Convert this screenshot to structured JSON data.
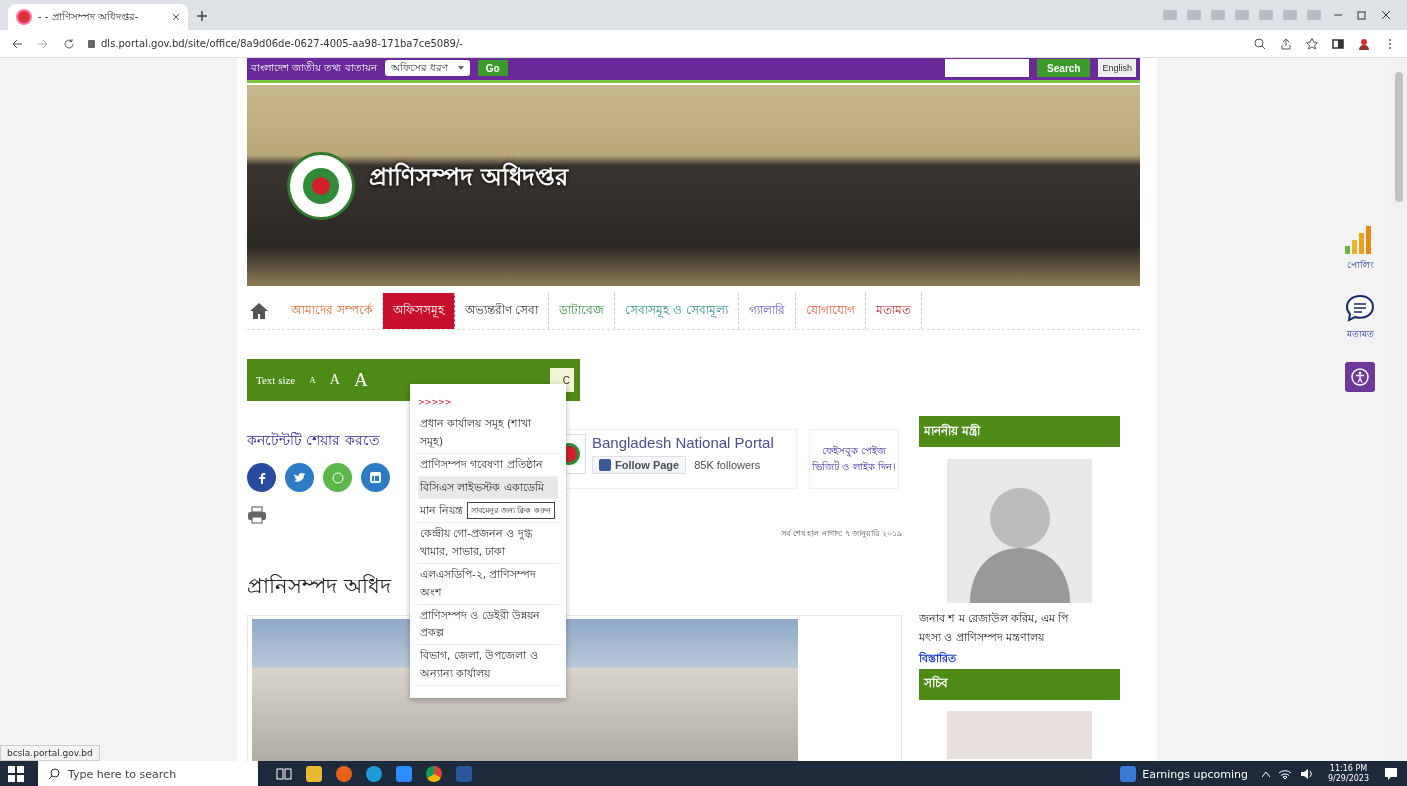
{
  "browser": {
    "tab_title": "- - প্রাণিসম্পদ অধিদপ্তর-",
    "address": "dls.portal.gov.bd/site/office/8a9d06de-0627-4005-aa98-171ba7ce5089/-"
  },
  "top_bar": {
    "portal_name": "বাংলাদেশ জাতীয় তথ্য বাতায়ন",
    "office_type_select": "অফিসের ধরণ",
    "go_button": "Go",
    "search_button": "Search",
    "language_button": "English"
  },
  "banner": {
    "title": "প্রাণিসম্পদ অধিদপ্তর"
  },
  "nav": [
    {
      "label": "আমাদের সম্পর্কে",
      "selected": false
    },
    {
      "label": "অফিসসমূহ",
      "selected": true
    },
    {
      "label": "অভ্যন্তরীণ সেবা",
      "selected": false
    },
    {
      "label": "ডাটাবেজ",
      "selected": false
    },
    {
      "label": "সেবাসমূহ ও সেবামূল্য",
      "selected": false
    },
    {
      "label": "গ্যালারি",
      "selected": false
    },
    {
      "label": "যোগাযোগ",
      "selected": false
    },
    {
      "label": "মতামত",
      "selected": false
    }
  ],
  "dropdown": {
    "marker": ">>>>>",
    "items": [
      {
        "label": "প্রধান কার্যালয় সমূহ (শাখা সমূহ)",
        "hovered": false
      },
      {
        "label": "প্রাণিসম্পদ গবেষণা প্রতিষ্ঠান",
        "hovered": false
      },
      {
        "label": "বিসিএস লাইভস্টক একাডেমি",
        "hovered": true
      },
      {
        "label": "মান নিয়ন্ত্র",
        "hovered": false,
        "tooltip": "সাবমেনুর জন্য ক্লিক করুন"
      },
      {
        "label": "কেন্দ্রীয় গো-প্রজনন ও দুগ্ধ খামার, সাভার, ঢাকা",
        "hovered": false
      },
      {
        "label": "এলএসডিপি-২, প্রাণিসম্পদ অংশ",
        "hovered": false
      },
      {
        "label": "প্রাণিসম্পদ ও ডেইরী উন্নয়ন প্রকল্প",
        "hovered": false
      },
      {
        "label": "বিভাগ, জেলা, উপজেলা ও অন্যান্য কার্যালয়",
        "hovered": false
      }
    ]
  },
  "text_size": {
    "label": "Text size",
    "sizes": [
      "A",
      "A",
      "A"
    ],
    "contrast_button": "C"
  },
  "share": {
    "label": "কনটেন্টটি শেয়ার করতে"
  },
  "facebook_widget": {
    "page_name": "Bangladesh National Portal",
    "follow_button": "Follow Page",
    "followers": "85K followers",
    "note": "ফেইসবুক পেইজ ভিজিট ও লাইক দিন।"
  },
  "last_updated": "সর্ব শেষ হাল নাগাদ: ৭ জানুয়ারি ২০১৯",
  "page_heading": "প্রানিসম্পদ অধিদ",
  "sidebar": [
    {
      "heading": "মাননীয় মন্ত্রী",
      "name": "জনাব শ ম রেজাউল করিম, এম পি",
      "designation": "মৎস্য ও প্রাণিসম্পদ মন্ত্রণালয়",
      "link": "বিস্তারিত"
    },
    {
      "heading": "সচিব"
    }
  ],
  "side_widgets": {
    "poll": "পোলিং",
    "feedback": "মতামত"
  },
  "status_url": "bcsla.portal.gov.bd",
  "taskbar": {
    "search_placeholder": "Type here to search",
    "news": "Earnings upcoming",
    "time": "11:16 PM",
    "date": "9/29/2023"
  }
}
